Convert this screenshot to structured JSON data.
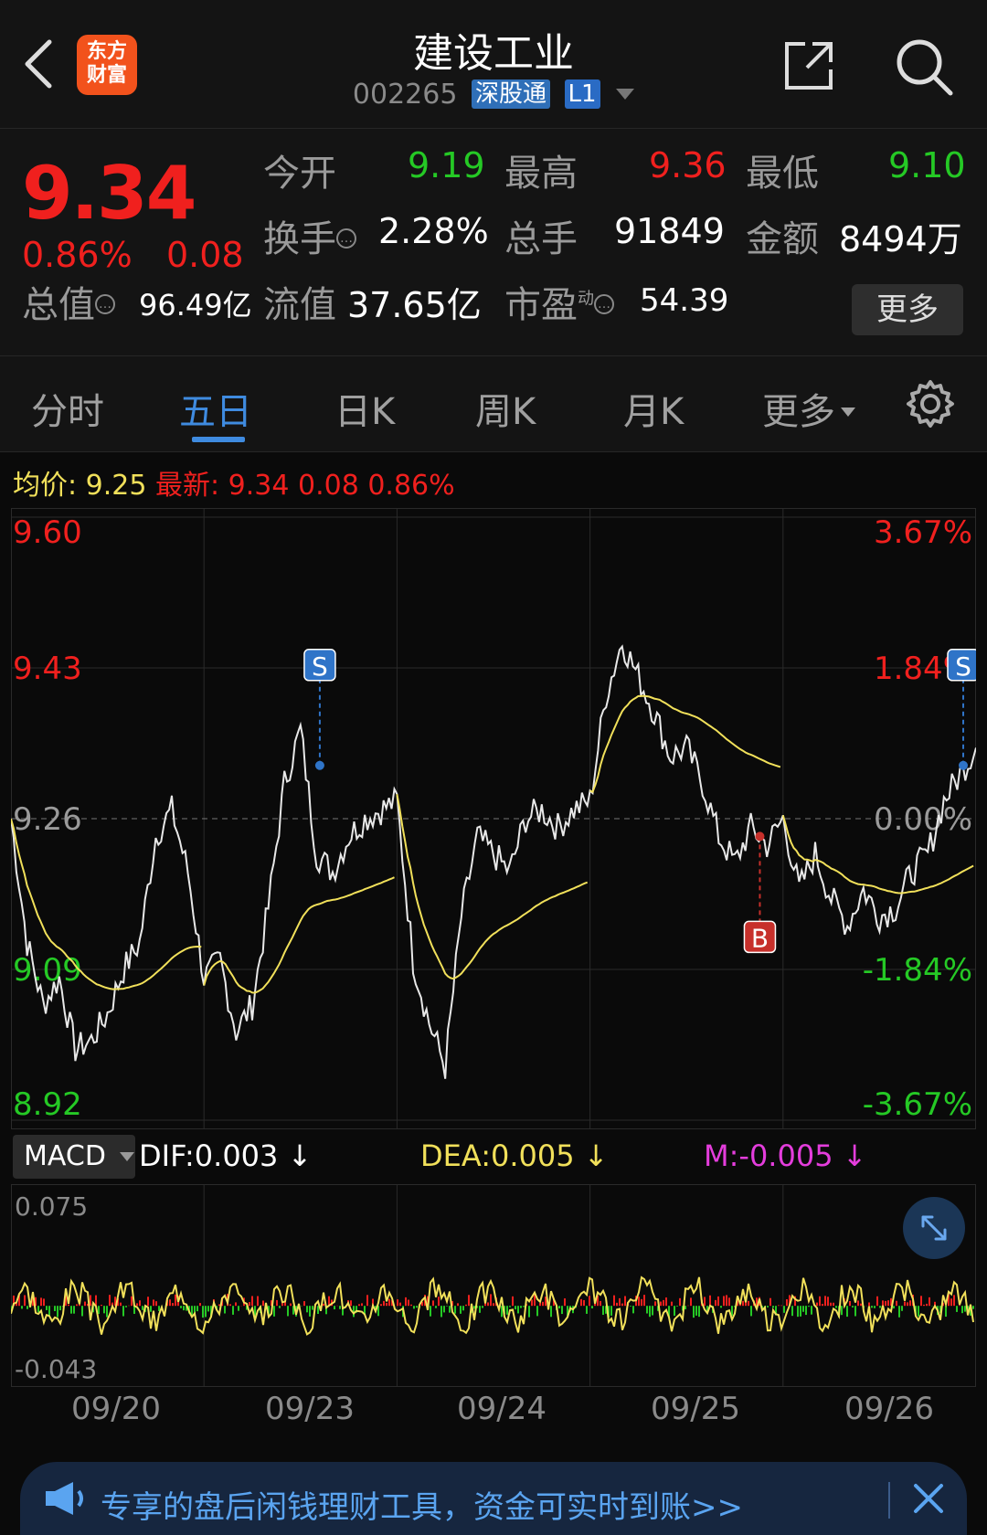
{
  "header": {
    "title": "建设工业",
    "code": "002265",
    "tag1": "深股通",
    "tag2": "L1",
    "logo_line1": "东方",
    "logo_line2": "财富"
  },
  "quote": {
    "price": "9.34",
    "pct": "0.86%",
    "chg": "0.08",
    "open_label": "今开",
    "open": "9.19",
    "high_label": "最高",
    "high": "9.36",
    "low_label": "最低",
    "low": "9.10",
    "turnover_label": "换手",
    "turnover": "2.28%",
    "volume_label": "总手",
    "volume": "91849",
    "amount_label": "金额",
    "amount": "8494万",
    "mcap_label": "总值",
    "mcap": "96.49亿",
    "float_label": "流值",
    "float": "37.65亿",
    "pe_label": "市盈",
    "pe_sup": "动",
    "pe": "54.39",
    "more": "更多"
  },
  "tabs": [
    "分时",
    "五日",
    "日K",
    "周K",
    "月K",
    "更多"
  ],
  "infoline": {
    "avg_label": "均价:",
    "avg": "9.25",
    "latest_label": "最新:",
    "latest": "9.34",
    "chg": "0.08",
    "pct": "0.86%"
  },
  "chart_data": [
    {
      "type": "line",
      "title": "",
      "series": [
        {
          "name": "均价",
          "color": "#f1e05a"
        }
      ],
      "y_labels_left": [
        "9.60",
        "9.43",
        "9.26",
        "9.09",
        "8.92"
      ],
      "y_labels_right": [
        "3.67%",
        "1.84%",
        "0.00%",
        "-1.84%",
        "-3.67%"
      ],
      "ylim": [
        8.92,
        9.6
      ],
      "prev_close": 9.26,
      "x_days": [
        "09/20",
        "09/23",
        "09/24",
        "09/25",
        "09/26"
      ],
      "markers": [
        {
          "label": "S",
          "day": "09/23",
          "price": 9.32
        },
        {
          "label": "B",
          "day": "09/25",
          "price": 9.24
        },
        {
          "label": "S",
          "day": "09/26",
          "price": 9.32
        }
      ],
      "price_close_points": [
        9.26,
        9.12,
        9.05,
        9.08,
        9.0,
        9.01,
        9.04,
        9.09,
        9.12,
        9.24,
        9.27,
        9.2,
        9.08,
        9.1,
        9.02,
        9.05,
        9.16,
        9.3,
        9.36,
        9.22,
        9.2,
        9.24,
        9.26,
        9.27,
        9.28,
        9.1,
        9.03,
        8.98,
        9.15,
        9.24,
        9.22,
        9.2,
        9.26,
        9.27,
        9.25,
        9.27,
        9.28,
        9.4,
        9.46,
        9.42,
        9.38,
        9.33,
        9.34,
        9.3,
        9.24,
        9.21,
        9.25,
        9.23,
        9.26,
        9.18,
        9.22,
        9.17,
        9.14,
        9.18,
        9.15,
        9.16,
        9.2,
        9.22,
        9.28,
        9.31,
        9.34
      ]
    },
    {
      "type": "line",
      "title": "MACD",
      "series": [
        {
          "name": "DIF",
          "value": "0.003",
          "color": "#ffffff"
        },
        {
          "name": "DEA",
          "value": "0.005",
          "color": "#f1e05a"
        },
        {
          "name": "M",
          "value": "-0.005",
          "color": "#e43ddc"
        }
      ],
      "y_labels": [
        "0.075",
        "-0.043"
      ],
      "ylim": [
        -0.043,
        0.075
      ]
    }
  ],
  "macd": {
    "selector": "MACD",
    "dif": "DIF:0.003 ↓",
    "dea": "DEA:0.005 ↓",
    "m": "M:-0.005 ↓"
  },
  "banner": {
    "text": "专享的盘后闲钱理财工具，资金可实时到账>>"
  },
  "colors": {
    "up": "#f0201e",
    "down": "#25c925",
    "accent": "#3f8be0",
    "avg": "#f1e05a"
  }
}
